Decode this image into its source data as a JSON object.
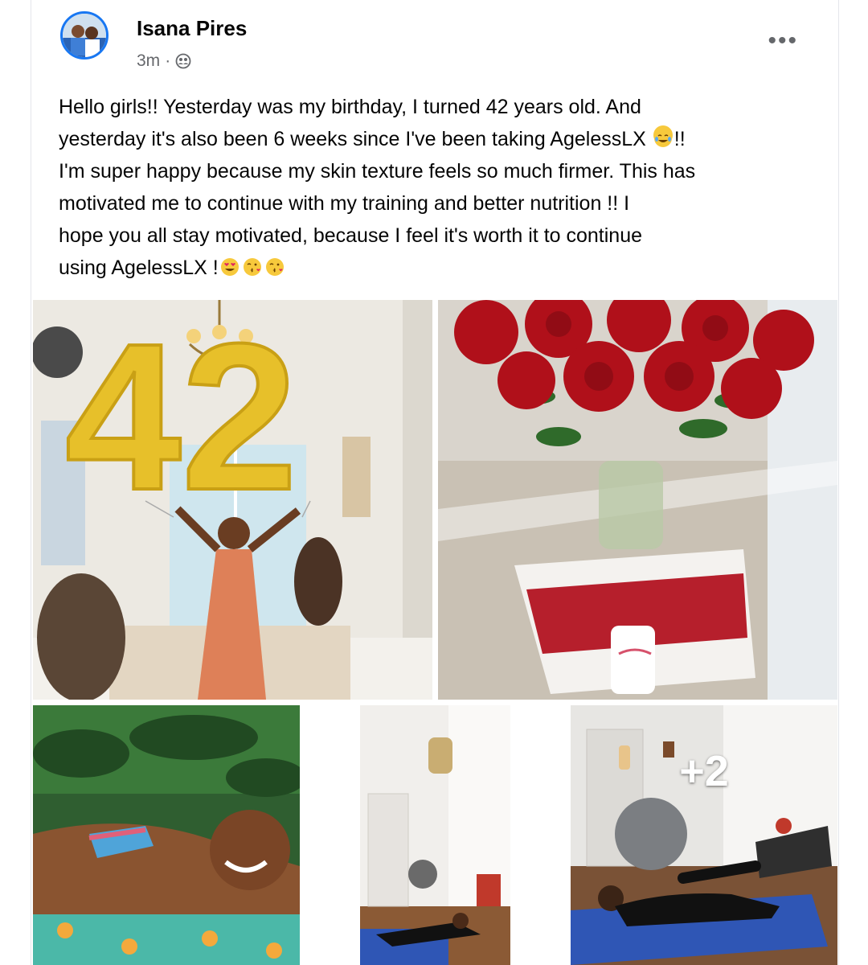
{
  "post": {
    "author": "Isana Pires",
    "timestamp": "3m",
    "separator": "·",
    "privacy_icon": "friends-icon",
    "more_icon": "more-options-icon",
    "text": {
      "line1": "Hello girls!! Yesterday was my birthday, I turned 42 years old. And",
      "line2_a": "yesterday it's also been 6 weeks since I've been  taking AgelessLX ",
      "line2_b": "!!",
      "line3": "I'm super happy because my skin texture feels so much firmer. This has",
      "line4": "motivated me to continue with my training and better nutrition !! I",
      "line5": "hope you all stay motivated, because I feel it's worth it to continue",
      "line6": "using AgelessLX !",
      "emojis": [
        "happy-tears-emoji",
        "heart-eyes-emoji",
        "kissing-emoji",
        "kissing-emoji"
      ]
    }
  },
  "photos": {
    "balloon_number": "42",
    "more_overlay": "+2",
    "items": [
      "birthday-balloons-photo",
      "roses-gift-photo",
      "sunbathing-photo",
      "gym-stretch-photo",
      "gym-ball-photo"
    ]
  },
  "colors": {
    "accent": "#1877f2",
    "text": "#050505",
    "secondary": "#65676b",
    "balloon_gold": "#e7c02a",
    "rose_red": "#b0101a"
  }
}
